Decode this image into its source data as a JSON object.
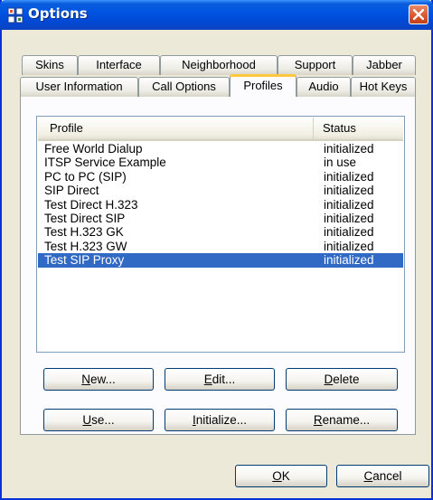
{
  "window": {
    "title": "Options",
    "accent": "#0054E3",
    "close_color": "#D9552A"
  },
  "tabs_row1": [
    "Skins",
    "Interface",
    "Neighborhood",
    "Support",
    "Jabber"
  ],
  "tabs_row2": [
    "User Information",
    "Call Options",
    "Profiles",
    "Audio",
    "Hot Keys"
  ],
  "active_tab": "Profiles",
  "list": {
    "columns": [
      "Profile",
      "Status"
    ],
    "rows": [
      [
        "Free World Dialup",
        "initialized"
      ],
      [
        "ITSP Service Example",
        "in use"
      ],
      [
        "PC to PC (SIP)",
        "initialized"
      ],
      [
        "SIP Direct",
        "initialized"
      ],
      [
        "Test Direct H.323",
        "initialized"
      ],
      [
        "Test Direct SIP",
        "initialized"
      ],
      [
        "Test H.323 GK",
        "initialized"
      ],
      [
        "Test H.323 GW",
        "initialized"
      ],
      [
        "Test SIP Proxy",
        "initialized"
      ]
    ],
    "selected_row": "Test SIP Proxy"
  },
  "buttons": {
    "new": {
      "u": "N",
      "rest": "ew..."
    },
    "edit": {
      "u": "E",
      "rest": "dit..."
    },
    "delete": {
      "u": "D",
      "rest": "elete"
    },
    "use": {
      "u": "U",
      "rest": "se..."
    },
    "initialize": {
      "u": "I",
      "rest": "nitialize..."
    },
    "rename": {
      "u": "R",
      "rest": "ename..."
    },
    "ok": {
      "u": "O",
      "rest": "K"
    },
    "cancel": {
      "u": "C",
      "rest": "ancel"
    }
  }
}
